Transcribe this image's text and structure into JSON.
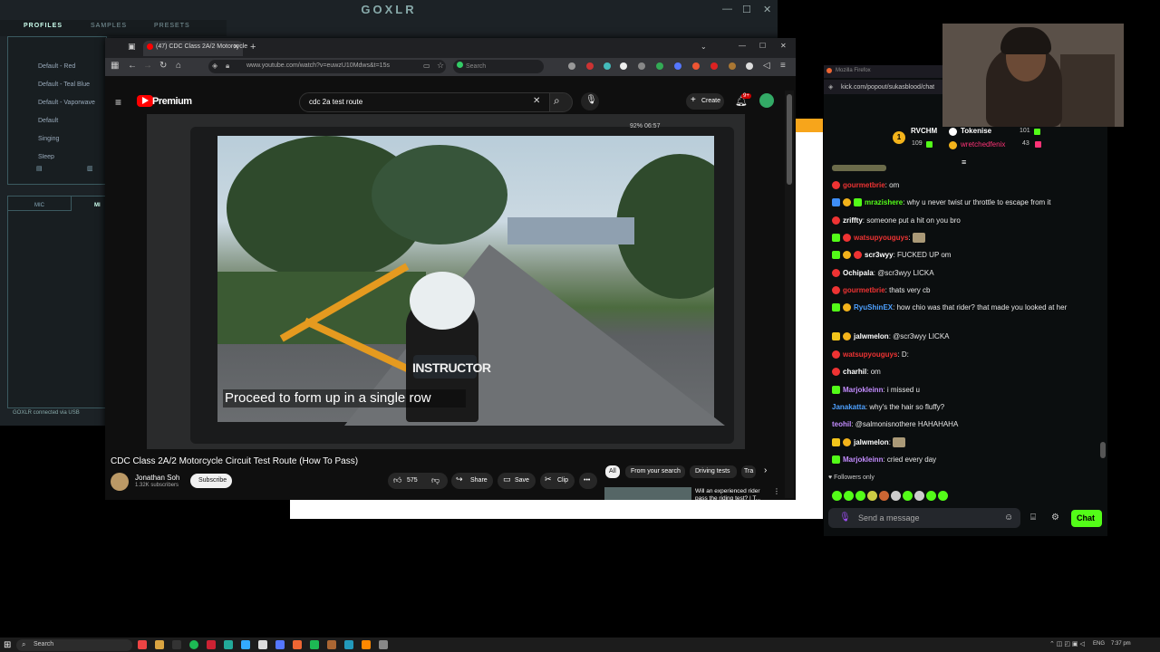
{
  "goxlr": {
    "title": "GOXLR",
    "tabs": [
      "PROFILES",
      "SAMPLES",
      "PRESETS"
    ],
    "profiles": [
      "Default - Red",
      "Default - Teal Blue",
      "Default - Vaporwave",
      "Default",
      "Singing",
      "Sleep"
    ],
    "mic_tab": "MIC",
    "mic_tab2": "MI",
    "status": "GOXLR connected via USB"
  },
  "browser": {
    "tab_title": "(47) CDC Class 2A/2 Motorcycle",
    "url": "www.youtube.com/watch?v=euwzU10Mdws&t=15s",
    "search_placeholder": "Search"
  },
  "youtube": {
    "brand": "Premium",
    "query": "cdc 2a test route",
    "create_label": "Create",
    "notif_count": "9+",
    "video": {
      "caption": "Proceed to form up in a single row",
      "vest_text": "INSTRUCTOR",
      "phone_status": "92% 06:57"
    },
    "title": "CDC Class 2A/2 Motorcycle Circuit Test Route (How To Pass)",
    "channel": "Jonathan Soh",
    "subscribers": "1.32K subscribers",
    "subscribe_label": "Subscribe",
    "likes": "575",
    "share_label": "Share",
    "save_label": "Save",
    "clip_label": "Clip",
    "chips": [
      "All",
      "From your search",
      "Driving tests",
      "Tra"
    ],
    "rec_title": "Will an experienced rider pass the riding test? | T..."
  },
  "chat": {
    "tab_title": "Mozilla Firefox",
    "url": "kick.com/popout/sukasblood/chat",
    "gifters": [
      {
        "name": "RVCHM",
        "count": "109",
        "rank": "1"
      },
      {
        "name": "Tokenise",
        "count": "101"
      },
      {
        "name": "wretchedfenix",
        "count": "43"
      }
    ],
    "messages": [
      {
        "user": "gourmetbrie",
        "color": "#e33",
        "text": "om"
      },
      {
        "user": "mrazishere",
        "color": "#53fc18",
        "text": "why u never twist ur throttle to escape from it"
      },
      {
        "user": "zriffty",
        "color": "#fff",
        "text": "someone put a hit on you bro"
      },
      {
        "user": "watsupyouguys",
        "color": "#e33",
        "text": ""
      },
      {
        "user": "scr3wyy",
        "color": "#fff",
        "text": "FUCKED UP om"
      },
      {
        "user": "Ochipala",
        "color": "#fff",
        "text": "@scr3wyy LICKA"
      },
      {
        "user": "gourmetbrie",
        "color": "#e33",
        "text": "thats very cb"
      },
      {
        "user": "RyuShinEX",
        "color": "#4ea1ff",
        "text": "how chio was that rider? that made you looked at her"
      },
      {
        "user": "jalwmelon",
        "color": "#fff",
        "text": "@scr3wyy LICKA"
      },
      {
        "user": "watsupyouguys",
        "color": "#e33",
        "text": "D:"
      },
      {
        "user": "charhil",
        "color": "#fff",
        "text": "om"
      },
      {
        "user": "Marjokleinn",
        "color": "#c38cff",
        "text": "i missed u"
      },
      {
        "user": "Janakatta",
        "color": "#4ea1ff",
        "text": "why's the hair so fluffy?"
      },
      {
        "user": "teohil",
        "color": "#c38cff",
        "text": "@salmonisnothere HAHAHAHA"
      },
      {
        "user": "jalwmelon",
        "color": "#fff",
        "text": ""
      },
      {
        "user": "Marjokleinn",
        "color": "#c38cff",
        "text": "cried every day"
      }
    ],
    "followers_only": "Followers only",
    "input_placeholder": "Send a message",
    "send_label": "Chat"
  },
  "taskbar": {
    "search_label": "Search",
    "lang": "ENG",
    "time": "7:37 pm"
  }
}
